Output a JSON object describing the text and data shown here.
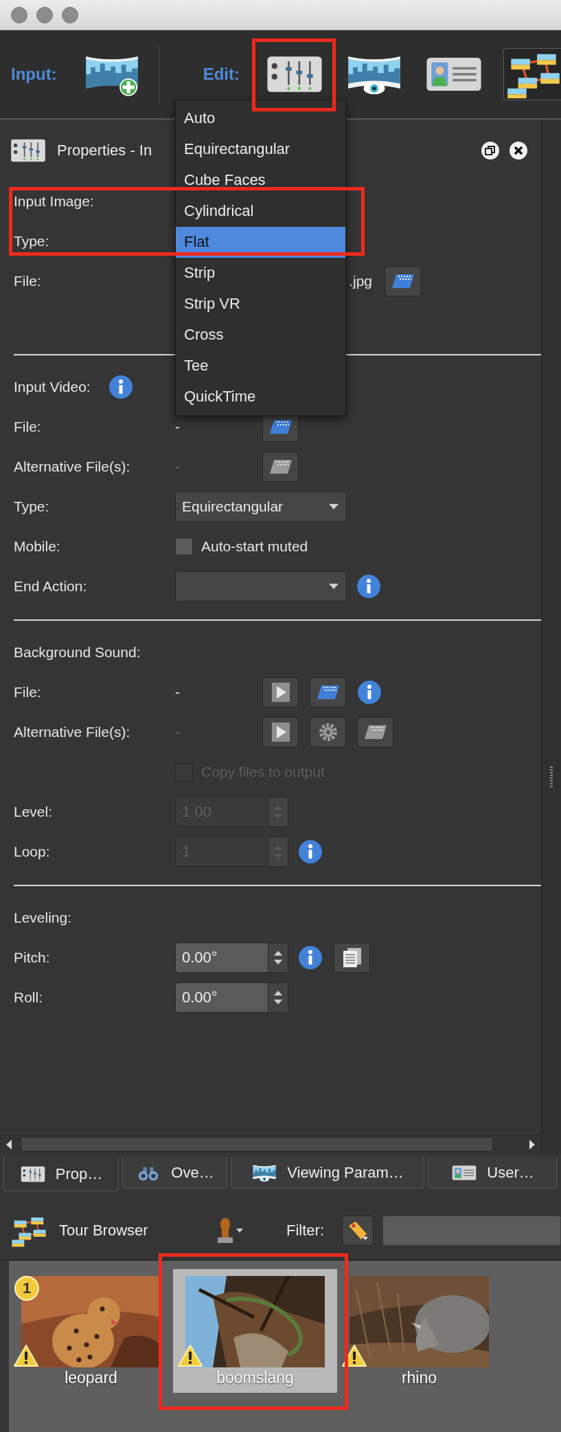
{
  "toolbar": {
    "groups": [
      {
        "label": "Input:",
        "buttons": [
          {
            "kind": "panorama-add",
            "selected": false
          }
        ]
      },
      {
        "label": "Edit:",
        "buttons": [
          {
            "kind": "sliders",
            "selected": false,
            "highlighted": true
          },
          {
            "kind": "panorama-eye",
            "selected": false
          },
          {
            "kind": "card",
            "selected": false
          },
          {
            "kind": "tour",
            "selected": true
          }
        ]
      }
    ]
  },
  "properties": {
    "title": "Properties - In",
    "sections": [
      {
        "rows": [
          {
            "kind": "heading",
            "label": "Input Image:",
            "highlighted": true
          },
          {
            "kind": "none",
            "label": "Type:",
            "highlighted": true,
            "menu": {
              "items": [
                {
                  "label": "Auto",
                  "selected": false
                },
                {
                  "label": "Equirectangular",
                  "selected": false
                },
                {
                  "label": "Cube Faces",
                  "selected": false
                },
                {
                  "label": "Cylindrical",
                  "selected": false
                },
                {
                  "label": "Flat",
                  "selected": true
                },
                {
                  "label": "Strip",
                  "selected": false
                },
                {
                  "label": "Strip VR",
                  "selected": false
                },
                {
                  "label": "Cross",
                  "selected": false
                },
                {
                  "label": "Tee",
                  "selected": false
                },
                {
                  "label": "QuickTime",
                  "selected": false
                }
              ]
            }
          },
          {
            "kind": "text",
            "label": "File:",
            "value": ".jpg",
            "controls": [
              {
                "kind": "folder",
                "disabled": false
              }
            ]
          }
        ]
      },
      {
        "rows": [
          {
            "kind": "heading",
            "label": "Input Video:",
            "controls": [
              {
                "kind": "info"
              }
            ]
          },
          {
            "kind": "text",
            "label": "File:",
            "value": "-",
            "controls": [
              {
                "kind": "folder",
                "disabled": false
              }
            ]
          },
          {
            "kind": "text",
            "label": "Alternative File(s):",
            "value": "-",
            "disabled": true,
            "controls": [
              {
                "kind": "folder",
                "disabled": true
              }
            ]
          },
          {
            "kind": "combo",
            "label": "Type:",
            "value": "Equirectangular"
          },
          {
            "kind": "checkbox",
            "label": "Mobile:",
            "text": "Auto-start muted",
            "checked": false,
            "disabled": false
          },
          {
            "kind": "combo",
            "label": "End Action:",
            "controls": [
              {
                "kind": "info"
              }
            ]
          }
        ]
      },
      {
        "rows": [
          {
            "kind": "heading",
            "label": "Background Sound:"
          },
          {
            "kind": "text",
            "label": "File:",
            "value": "-",
            "controls": [
              {
                "kind": "play",
                "disabled": false
              },
              {
                "kind": "folder",
                "disabled": false
              },
              {
                "kind": "info"
              }
            ]
          },
          {
            "kind": "text",
            "label": "Alternative File(s):",
            "value": "-",
            "disabled": true,
            "controls": [
              {
                "kind": "play",
                "disabled": false
              },
              {
                "kind": "gear",
                "disabled": false
              },
              {
                "kind": "folder",
                "disabled": true
              }
            ]
          },
          {
            "kind": "checkbox",
            "text": "Copy files to output",
            "checked": false,
            "disabled": true
          },
          {
            "kind": "spin",
            "label": "Level:",
            "value": "1.00",
            "disabled": true
          },
          {
            "kind": "spin",
            "label": "Loop:",
            "value": "1",
            "disabled": true,
            "controls": [
              {
                "kind": "info"
              }
            ]
          }
        ]
      },
      {
        "rows": [
          {
            "kind": "heading",
            "label": "Leveling:"
          },
          {
            "kind": "spin",
            "label": "Pitch:",
            "value": "0.00°",
            "disabled": false,
            "controls": [
              {
                "kind": "info"
              },
              {
                "kind": "copy",
                "disabled": false
              }
            ]
          },
          {
            "kind": "spin",
            "label": "Roll:",
            "value": "0.00°",
            "disabled": false
          }
        ]
      }
    ]
  },
  "tabs": [
    {
      "label": "Prop…",
      "kind": "sliders",
      "selected": true
    },
    {
      "label": "Ove…",
      "kind": "binoculars",
      "selected": false
    },
    {
      "label": "Viewing Param…",
      "kind": "panorama-eye",
      "selected": false
    },
    {
      "label": "User…",
      "kind": "card",
      "selected": false
    }
  ],
  "tour_browser": {
    "title": "Tour Browser",
    "filter_label": "Filter:",
    "items": [
      {
        "name": "leopard",
        "selected": false,
        "badge": "1",
        "warning": true
      },
      {
        "name": "boomslang",
        "selected": true,
        "highlighted": true,
        "warning": true
      },
      {
        "name": "rhino",
        "selected": false,
        "warning": true
      }
    ]
  }
}
